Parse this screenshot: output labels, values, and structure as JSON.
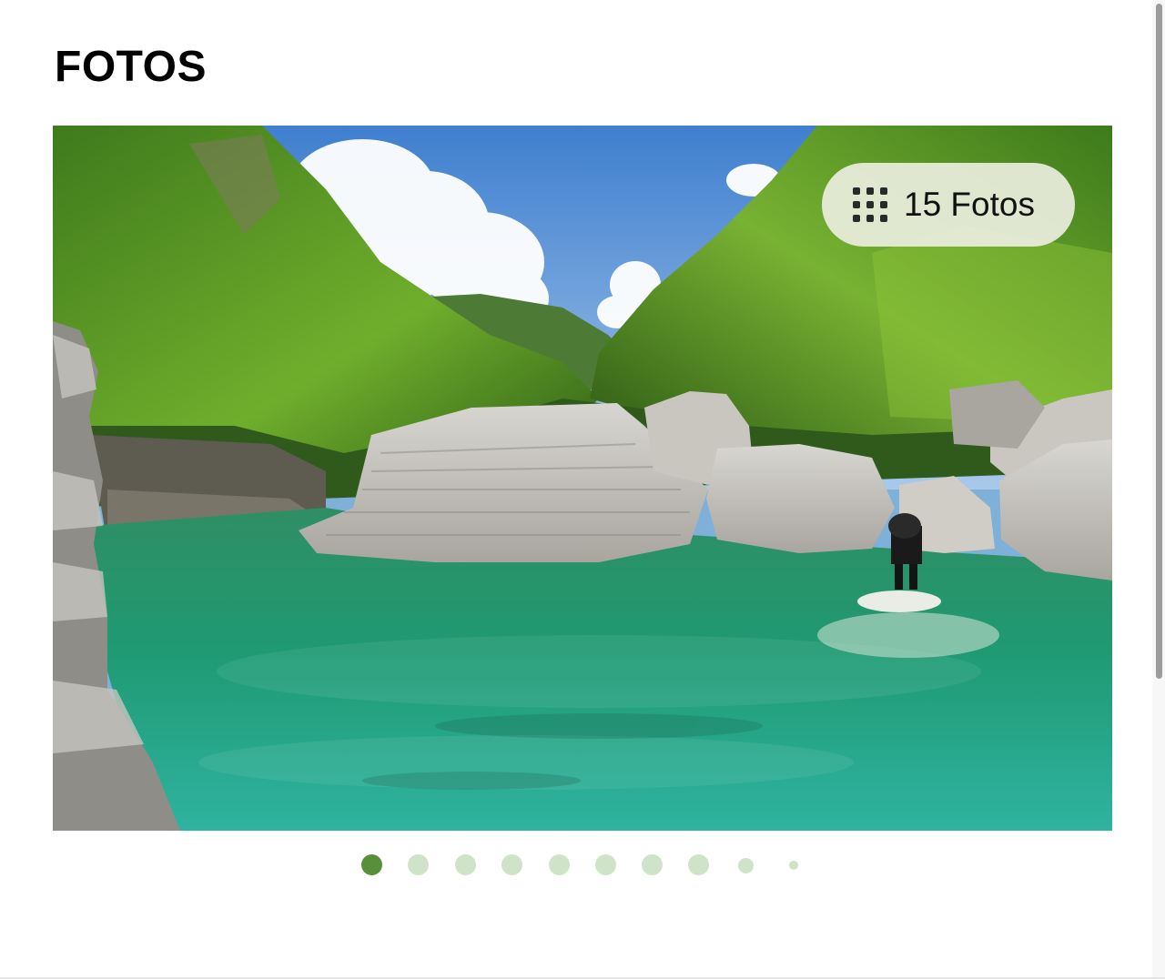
{
  "section": {
    "title": "FOTOS"
  },
  "gallery": {
    "photo_count_label": "15 Fotos",
    "photo_count_icon": "grid-dots-icon",
    "current_index": 1,
    "pager_dots": 10
  },
  "colors": {
    "dot_active": "#5a8f3a",
    "dot_inactive": "#cfe3c8",
    "badge_bg": "#eceede"
  }
}
